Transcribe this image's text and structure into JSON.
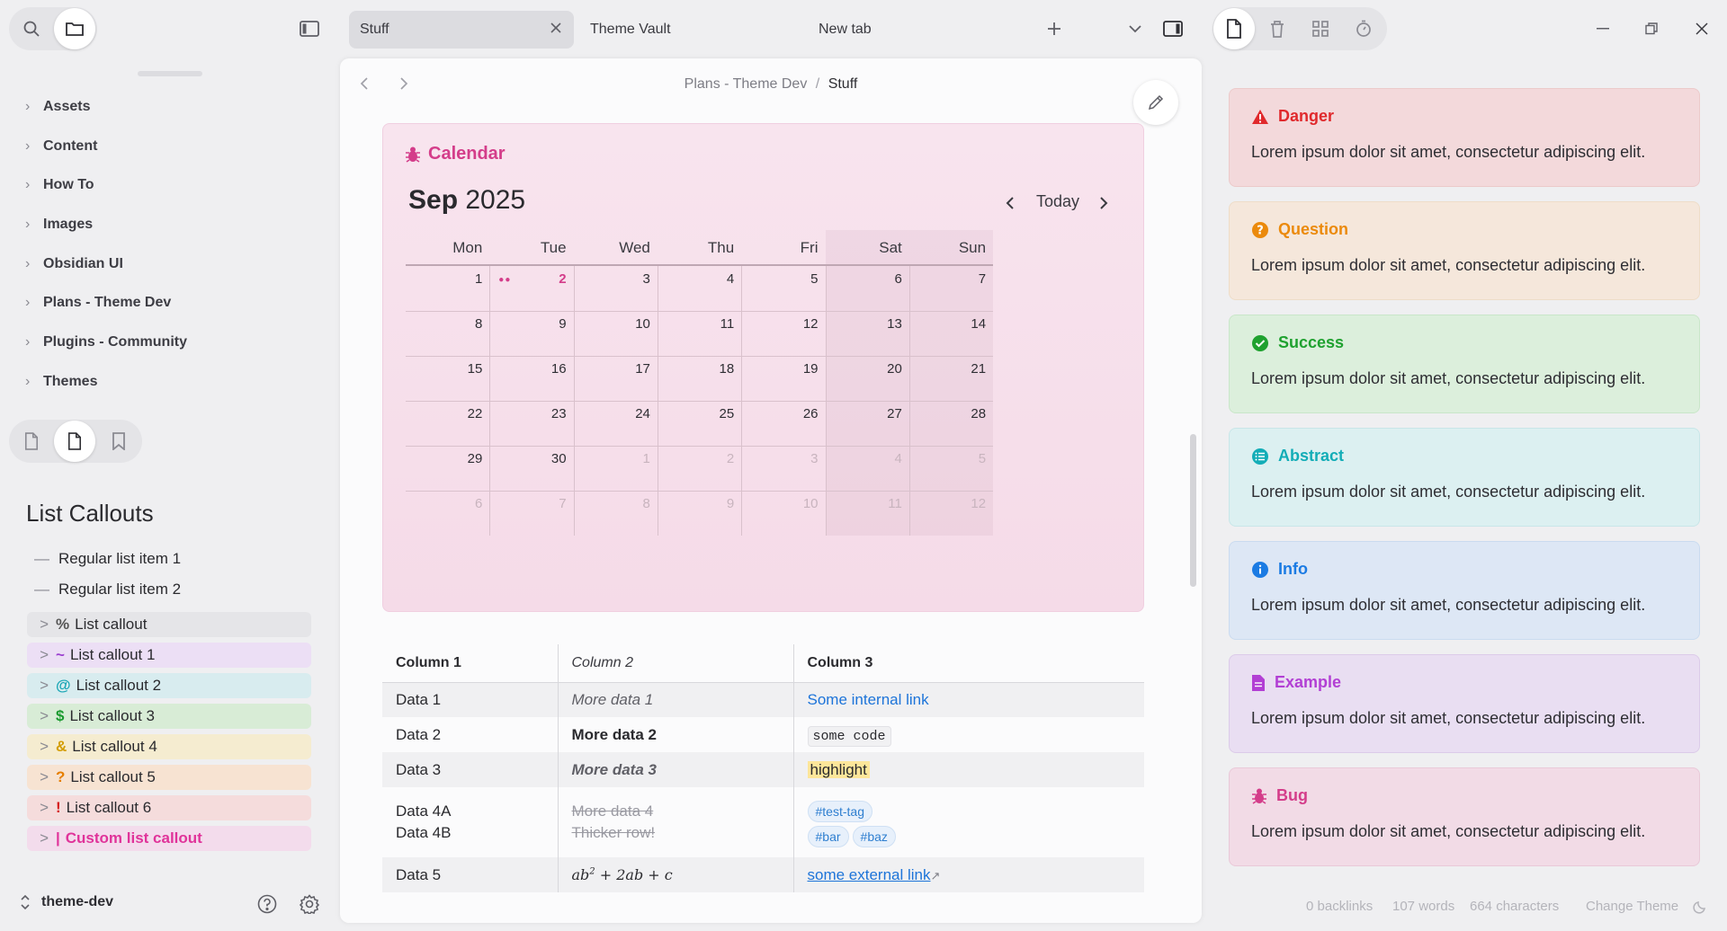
{
  "tabs": [
    {
      "label": "Stuff",
      "active": true
    },
    {
      "label": "Theme Vault",
      "active": false
    },
    {
      "label": "New tab",
      "active": false
    }
  ],
  "breadcrumb": {
    "parent": "Plans - Theme Dev",
    "sep": "/",
    "current": "Stuff"
  },
  "sidebar": {
    "folders": [
      "Assets",
      "Content",
      "How To",
      "Images",
      "Obsidian UI",
      "Plans - Theme Dev",
      "Plugins - Community",
      "Themes"
    ],
    "vault_name": "theme-dev"
  },
  "list_callouts": {
    "heading": "List Callouts",
    "regular": [
      "Regular list item 1",
      "Regular list item 2"
    ],
    "items": [
      {
        "sym": "%",
        "label": "List callout",
        "bg": "#e5e5e8",
        "color": "#555"
      },
      {
        "sym": "~",
        "label": "List callout 1",
        "bg": "#ecdff5",
        "color": "#9b3fd0"
      },
      {
        "sym": "@",
        "label": "List callout 2",
        "bg": "#d8ecef",
        "color": "#1aa6b5"
      },
      {
        "sym": "$",
        "label": "List callout 3",
        "bg": "#d8ecd6",
        "color": "#1a9a2e"
      },
      {
        "sym": "&",
        "label": "List callout 4",
        "bg": "#f5ecd0",
        "color": "#d39c00"
      },
      {
        "sym": "?",
        "label": "List callout 5",
        "bg": "#f7e3d2",
        "color": "#e67e00"
      },
      {
        "sym": "!",
        "label": "List callout 6",
        "bg": "#f5dcdc",
        "color": "#d51a1a"
      },
      {
        "sym": "|",
        "label": "Custom list callout",
        "bg": "#f3dcec",
        "color": "#e0339a"
      }
    ]
  },
  "calendar": {
    "title": "Calendar",
    "month": "Sep",
    "year": "2025",
    "today_label": "Today",
    "days_of_week": [
      "Mon",
      "Tue",
      "Wed",
      "Thu",
      "Fri",
      "Sat",
      "Sun"
    ],
    "weeks": [
      [
        "1",
        "2",
        "3",
        "4",
        "5",
        "6",
        "7"
      ],
      [
        "8",
        "9",
        "10",
        "11",
        "12",
        "13",
        "14"
      ],
      [
        "15",
        "16",
        "17",
        "18",
        "19",
        "20",
        "21"
      ],
      [
        "22",
        "23",
        "24",
        "25",
        "26",
        "27",
        "28"
      ],
      [
        "29",
        "30",
        "1",
        "2",
        "3",
        "4",
        "5"
      ],
      [
        "6",
        "7",
        "8",
        "9",
        "10",
        "11",
        "12"
      ]
    ],
    "dim_from_row4_col": 2,
    "highlight_day": "2",
    "accent": "#d43d8a"
  },
  "table": {
    "headers": [
      "Column 1",
      "Column 2",
      "Column 3"
    ],
    "rows": [
      {
        "c1": "Data 1",
        "c2": "More data 1",
        "c3": "Some internal link"
      },
      {
        "c1": "Data 2",
        "c2": "More data 2",
        "c3": "some code"
      },
      {
        "c1": "Data 3",
        "c2": "More data 3",
        "c3": "highlight"
      },
      {
        "c1a": "Data 4A",
        "c1b": "Data 4B",
        "c2a": "More data 4",
        "c2b": "Thicker row!",
        "tags": [
          "#test-tag",
          "#bar",
          "#baz"
        ]
      },
      {
        "c1": "Data 5",
        "c3": "some external link"
      }
    ]
  },
  "callouts": [
    {
      "title": "Danger",
      "body": "Lorem ipsum dolor sit amet, consectetur adipiscing elit.",
      "color": "#e0292c",
      "bg": "#f3d9db",
      "border": "#eccaca",
      "icon": "warning-triangle-icon"
    },
    {
      "title": "Question",
      "body": "Lorem ipsum dolor sit amet, consectetur adipiscing elit.",
      "color": "#eb8a0c",
      "bg": "#f5e7db",
      "border": "#eeddc8",
      "icon": "question-circle-icon"
    },
    {
      "title": "Success",
      "body": "Lorem ipsum dolor sit amet, consectetur adipiscing elit.",
      "color": "#1fa12f",
      "bg": "#dcefdc",
      "border": "#c9e6c9",
      "icon": "check-circle-icon"
    },
    {
      "title": "Abstract",
      "body": "Lorem ipsum dolor sit amet, consectetur adipiscing elit.",
      "color": "#13adb7",
      "bg": "#dcf0f1",
      "border": "#c8e6e8",
      "icon": "list-icon"
    },
    {
      "title": "Info",
      "body": "Lorem ipsum dolor sit amet, consectetur adipiscing elit.",
      "color": "#1b7be3",
      "bg": "#dde7f5",
      "border": "#cadbf0",
      "icon": "info-circle-icon"
    },
    {
      "title": "Example",
      "body": "Lorem ipsum dolor sit amet, consectetur adipiscing elit.",
      "color": "#b23fd4",
      "bg": "#e9def2",
      "border": "#dccbe9",
      "icon": "file-icon"
    },
    {
      "title": "Bug",
      "body": "Lorem ipsum dolor sit amet, consectetur adipiscing elit.",
      "color": "#d43d8a",
      "bg": "#f2dbe6",
      "border": "#e9c9d8",
      "icon": "bug-icon"
    }
  ],
  "status": {
    "backlinks": "0 backlinks",
    "words": "107 words",
    "chars": "664 characters",
    "theme": "Change Theme"
  }
}
